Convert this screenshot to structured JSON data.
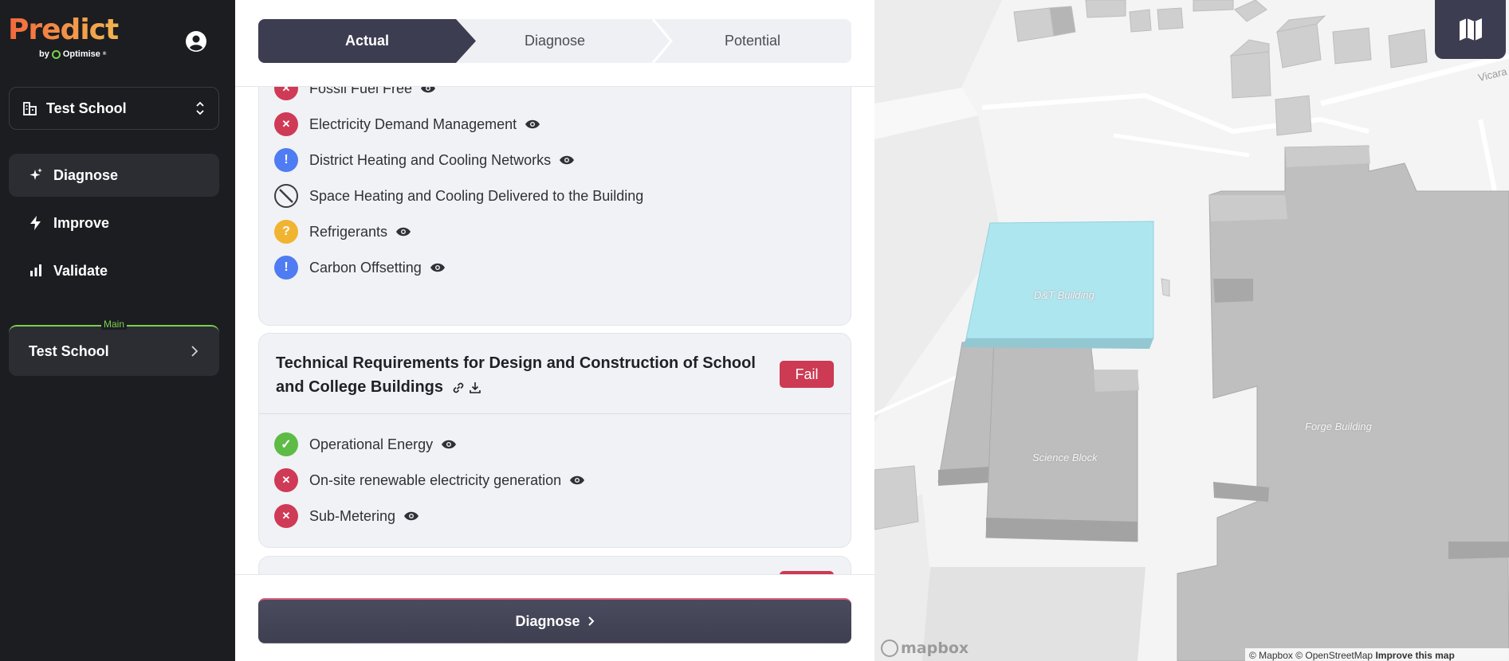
{
  "sidebar": {
    "logo": {
      "word": "Predict",
      "by": "by",
      "brand": "Optimise",
      "brand_mark": "®"
    },
    "site_selector": {
      "label": "Test School"
    },
    "nav": [
      {
        "label": "Diagnose",
        "icon": "sparkles-icon",
        "active": true
      },
      {
        "label": "Improve",
        "icon": "lightning-icon",
        "active": false
      },
      {
        "label": "Validate",
        "icon": "bar-chart-icon",
        "active": false
      }
    ],
    "main_site": {
      "tag": "Main",
      "name": "Test School"
    }
  },
  "steps": [
    {
      "label": "Actual",
      "active": true
    },
    {
      "label": "Diagnose",
      "active": false
    },
    {
      "label": "Potential",
      "active": false
    }
  ],
  "card1": {
    "items": [
      {
        "label": "Fossil Fuel Free",
        "status": "fail",
        "viewable": true
      },
      {
        "label": "Electricity Demand Management",
        "status": "fail",
        "viewable": true
      },
      {
        "label": "District Heating and Cooling Networks",
        "status": "info",
        "viewable": true
      },
      {
        "label": "Space Heating and Cooling Delivered to the Building",
        "status": "not-applicable",
        "viewable": false
      },
      {
        "label": "Refrigerants",
        "status": "unknown",
        "viewable": true
      },
      {
        "label": "Carbon Offsetting",
        "status": "info",
        "viewable": true
      }
    ]
  },
  "card2": {
    "title": "Technical Requirements for Design and Construction of School and College Buildings",
    "badge": "Fail",
    "items": [
      {
        "label": "Operational Energy",
        "status": "pass",
        "viewable": true
      },
      {
        "label": "On-site renewable electricity generation",
        "status": "fail",
        "viewable": true
      },
      {
        "label": "Sub-Metering",
        "status": "fail",
        "viewable": true
      }
    ]
  },
  "cta": {
    "label": "Diagnose"
  },
  "map": {
    "buildings": [
      {
        "label": "D&T Building",
        "highlighted": true
      },
      {
        "label": "Science Block",
        "highlighted": false
      },
      {
        "label": "Forge Building",
        "highlighted": false
      }
    ],
    "road_label": "Vicara",
    "mapbox_logo": "mapbox",
    "attribution": {
      "text": "© Mapbox © OpenStreetMap",
      "link": "Improve this map"
    },
    "highlight_color": "#aee6f0"
  },
  "colors": {
    "sidebar_bg": "#1c1d21",
    "accent_dark": "#3d3d52",
    "pass": "#5dbb46",
    "fail": "#cf3a56",
    "info": "#4f7cf2",
    "warn": "#f0b430",
    "main_green": "#7ad04f"
  }
}
